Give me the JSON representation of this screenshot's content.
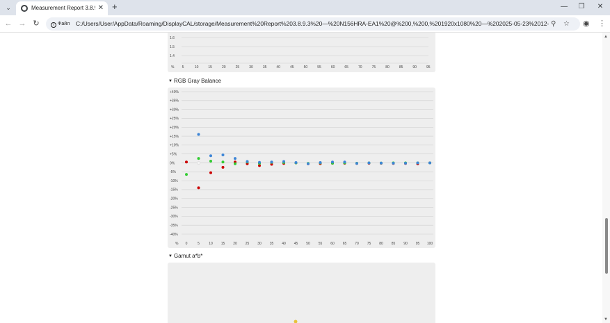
{
  "browser": {
    "tab_title": "Measurement Report 3.8.9.3 —",
    "tab_close": "✕",
    "new_tab": "+",
    "window": {
      "minimize": "—",
      "maximize": "❐",
      "close": "✕"
    },
    "site_info": "Файл",
    "url": "C:/Users/User/AppData/Roaming/DisplayCAL/storage/Measurement%20Report%203.8.9.3%20—%20N156HRA-EA1%20@%200,%200,%201920x1080%20—%202025-05-23%2012-16.html"
  },
  "icons": {
    "tab_menu": "chevron-down-icon",
    "favicon": "globe-icon",
    "back": "arrow-left-icon",
    "forward": "arrow-right-icon",
    "reload": "reload-icon",
    "zoom": "zoom-icon",
    "bookmark": "star-icon",
    "profile": "profile-icon",
    "menu": "kebab-menu-icon"
  },
  "colors": {
    "panel_bg": "#eeeeee",
    "grid": "#cfcfcf",
    "red": "#cc0000",
    "green": "#33cc33",
    "blue": "#3d85d6",
    "gamut_marker": "#e8c23a"
  },
  "sections": {
    "gray_balance_title": "RGB Gray Balance",
    "gamut_title": "Gamut a*b*"
  },
  "chart_data": [
    {
      "type": "line",
      "title": "",
      "x_unit_label": "%",
      "x_ticks": [
        5,
        10,
        15,
        20,
        25,
        30,
        35,
        40,
        45,
        50,
        55,
        60,
        65,
        70,
        75,
        80,
        85,
        90,
        95
      ],
      "y_ticks_visible": [
        "1.6",
        "1.5",
        "1.4"
      ],
      "grid": true
    },
    {
      "type": "scatter",
      "title": "RGB Gray Balance",
      "x_unit_label": "%",
      "x": [
        0,
        5,
        10,
        15,
        20,
        25,
        30,
        35,
        40,
        45,
        50,
        55,
        60,
        65,
        70,
        75,
        80,
        85,
        90,
        95,
        100
      ],
      "y_ticks": [
        "+40%",
        "+35%",
        "+30%",
        "+25%",
        "+20%",
        "+15%",
        "+10%",
        "+5%",
        "0%",
        "-5%",
        "-10%",
        "-15%",
        "-20%",
        "-25%",
        "-30%",
        "-35%",
        "-40%"
      ],
      "ylim": [
        -40,
        40
      ],
      "grid": true,
      "series": [
        {
          "color": "red",
          "values": [
            0.5,
            -14,
            -5.5,
            -2.5,
            0.5,
            -0.5,
            -1.5,
            -0.8,
            -0.3,
            0,
            -0.5,
            -0.4,
            -0.2,
            -0.2,
            -0.3,
            -0.2,
            -0.2,
            -0.3,
            -0.3,
            -0.5,
            0
          ]
        },
        {
          "color": "green",
          "values": [
            -6.5,
            2.5,
            1,
            0.5,
            -0.5,
            0.5,
            -0.3,
            0.3,
            0.2,
            0,
            -0.3,
            0,
            -0.2,
            0,
            -0.2,
            0,
            -0.1,
            0,
            0,
            0,
            0
          ]
        },
        {
          "color": "blue",
          "values": [
            null,
            16,
            4,
            4.5,
            2.5,
            0.8,
            0.3,
            0.5,
            0.8,
            0.2,
            -0.5,
            0.2,
            0.5,
            0.5,
            -0.3,
            0,
            -0.1,
            -0.2,
            -0.2,
            0,
            0
          ]
        }
      ]
    }
  ]
}
